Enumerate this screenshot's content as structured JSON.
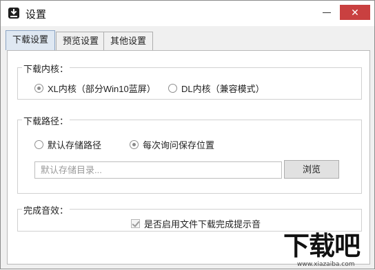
{
  "window": {
    "title": "设置",
    "close_label": "✕",
    "minimize_label": ""
  },
  "tabs": [
    {
      "label": "下载设置",
      "active": true
    },
    {
      "label": "预览设置",
      "active": false
    },
    {
      "label": "其他设置",
      "active": false
    }
  ],
  "kernel_group": {
    "title": "下载内核：",
    "options": [
      {
        "label": "XL内核（部分Win10蓝屏）",
        "checked": true
      },
      {
        "label": "DL内核（兼容模式）",
        "checked": false
      }
    ]
  },
  "path_group": {
    "title": "下载路径：",
    "options": [
      {
        "label": "默认存储路径",
        "checked": false
      },
      {
        "label": "每次询问保存位置",
        "checked": true
      }
    ],
    "directory_input": {
      "value": "",
      "placeholder": "默认存储目录..."
    },
    "browse_label": "浏览"
  },
  "sound_group": {
    "title": "完成音效：",
    "checkbox_label": "是否启用文件下载完成提示音",
    "checked": true
  },
  "watermark": {
    "logo_text": "下载吧",
    "url_text": "www.xiazaiba.com"
  },
  "colors": {
    "close_button": "#c94040",
    "active_tab": "#dfe8f2"
  }
}
